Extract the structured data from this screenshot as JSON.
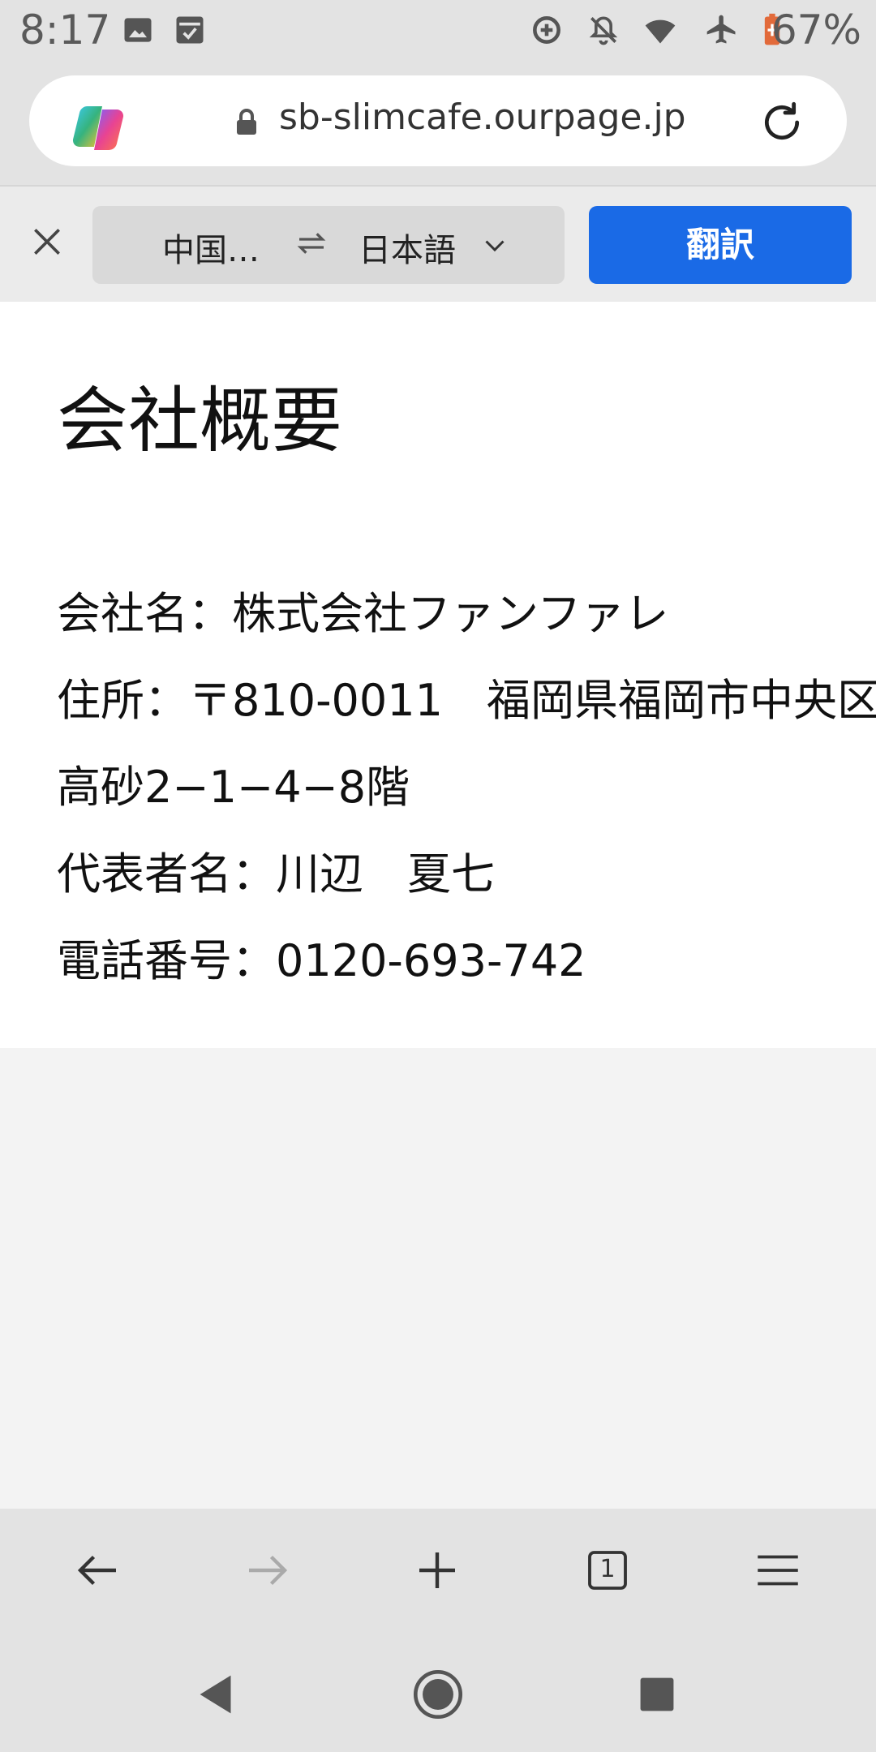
{
  "status_bar": {
    "time": "8:17",
    "battery": "67%",
    "icons": [
      "image-icon",
      "calendar-check-icon",
      "data-saver-icon",
      "bell-off-icon",
      "wifi-icon",
      "airplane-icon",
      "battery-icon"
    ]
  },
  "address_bar": {
    "url": "sb-slimcafe.ourpage.jp"
  },
  "translate_bar": {
    "from_language": "中国…",
    "to_language": "日本語",
    "translate_button": "翻訳"
  },
  "page": {
    "title": "会社概要",
    "lines": [
      "会社名：株式会社ファンファレ",
      "住所：〒810-0011　福岡県福岡市中央区",
      "高砂2−1−4−8階",
      "代表者名：川辺　夏七",
      "電話番号：0120-693-742"
    ]
  },
  "bottom_nav": {
    "tab_count": "1"
  },
  "colors": {
    "accent": "#1a6ae6",
    "chrome_bg": "#e3e3e3",
    "page_bg": "#ffffff"
  }
}
